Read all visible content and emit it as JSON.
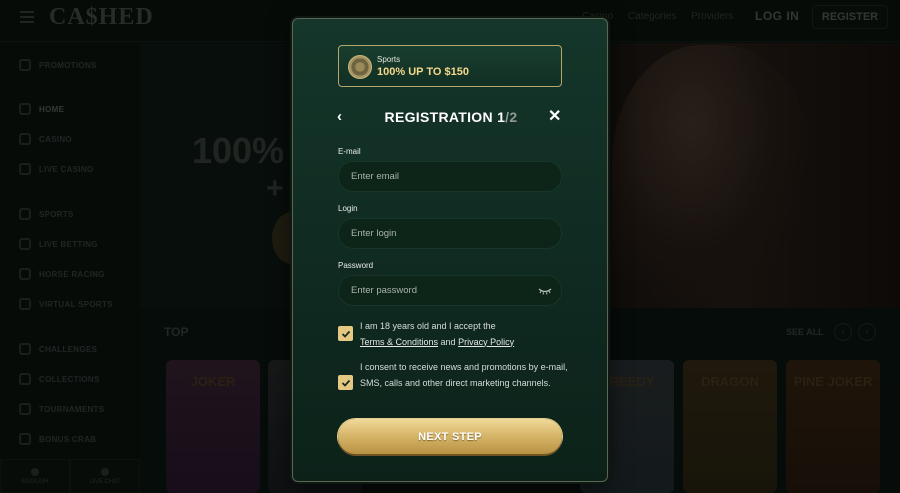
{
  "header": {
    "logo": "CA$HED",
    "links": [
      "Casino",
      "Categories",
      "Providers"
    ],
    "login_label": "LOG IN",
    "register_label": "REGISTER"
  },
  "sidebar": {
    "items": [
      {
        "label": "PROMOTIONS",
        "icon": "gift-icon"
      },
      {
        "label": "HOME",
        "icon": "home-icon"
      },
      {
        "label": "CASINO",
        "icon": "cards-icon"
      },
      {
        "label": "LIVE CASINO",
        "icon": "live-icon"
      },
      {
        "label": "SPORTS",
        "icon": "ball-icon"
      },
      {
        "label": "LIVE BETTING",
        "icon": "tv-icon"
      },
      {
        "label": "HORSE RACING",
        "icon": "horse-icon"
      },
      {
        "label": "VIRTUAL SPORTS",
        "icon": "gamepad-icon"
      },
      {
        "label": "CHALLENGES",
        "icon": "medal-icon"
      },
      {
        "label": "COLLECTIONS",
        "icon": "grid-icon"
      },
      {
        "label": "TOURNAMENTS",
        "icon": "trophy-icon"
      },
      {
        "label": "BONUS CRAB",
        "icon": "crab-icon"
      }
    ],
    "footer": {
      "language": "ENGLISH",
      "chat": "LIVE CHAT"
    }
  },
  "hero": {
    "headline": "100%",
    "plus": "+"
  },
  "games_section": {
    "title": "TOP",
    "see_all": "SEE ALL",
    "tiles": [
      "JOKER",
      "",
      "",
      "",
      "",
      "GREEDY",
      "DRAGON",
      "PINE JOKER"
    ]
  },
  "modal": {
    "promo": {
      "category": "Sports",
      "title": "100% UP TO $150"
    },
    "title_main": "REGISTRATION 1",
    "title_step": "/2",
    "back_icon": "chevron-left-icon",
    "close_icon": "close-icon",
    "email": {
      "label": "E-mail",
      "placeholder": "Enter email",
      "value": ""
    },
    "login": {
      "label": "Login",
      "placeholder": "Enter login",
      "value": ""
    },
    "password": {
      "label": "Password",
      "placeholder": "Enter password",
      "value": ""
    },
    "consent_age": {
      "checked": true,
      "text_before": "I am 18 years old and I accept the",
      "terms_link": "Terms & Conditions",
      "and": "and",
      "privacy_link": "Privacy Policy"
    },
    "consent_marketing": {
      "checked": true,
      "text": "I consent to receive news and promotions by e-mail, SMS, calls and other direct marketing channels."
    },
    "next_label": "NEXT STEP"
  },
  "colors": {
    "modal_bg": "#15362a",
    "accent_gold": "#e5c983",
    "promo_text": "#f4d98b"
  }
}
